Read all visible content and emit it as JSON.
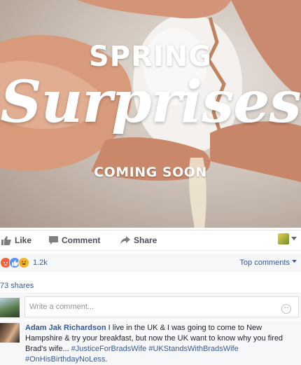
{
  "hero": {
    "line1": "SPRING",
    "line2": "Surprises",
    "line3": "COMING SOON"
  },
  "actions": {
    "like": "Like",
    "comment": "Comment",
    "share": "Share"
  },
  "reactions": {
    "count": "1.2k",
    "icons": [
      "angry-icon",
      "like-icon",
      "haha-icon"
    ],
    "top_comments": "Top comments"
  },
  "shares": "73 shares",
  "compose": {
    "placeholder": "Write a comment..."
  },
  "comment": {
    "author": "Adam Jak Richardson",
    "text": " I live in the UK & I was going to come to New Hampshire & try your breakfast, but now the UK want to know why you fired Brad's wife... ",
    "tags": [
      "#JusticeForBradsWife",
      "#UKStandsWithBradsWife",
      "#OnHisBirthdayNoLess"
    ],
    "tail": "."
  },
  "colors": {
    "link": "#365899",
    "action_text": "#4b4f56",
    "surface": "#f6f7f9"
  }
}
